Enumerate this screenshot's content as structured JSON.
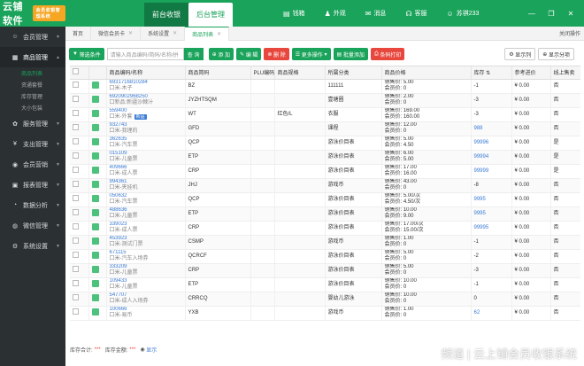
{
  "app": {
    "logo": "云铺软件",
    "version_badge": "会员收银管理系统"
  },
  "main_tabs": [
    "前台收银",
    "后台管理"
  ],
  "top_links": [
    {
      "icon": "cash-icon",
      "label": "钱箱"
    },
    {
      "icon": "shirt-icon",
      "label": "外观"
    },
    {
      "icon": "mail-icon",
      "label": "消息"
    },
    {
      "icon": "headset-icon",
      "label": "客服"
    },
    {
      "icon": "user-icon",
      "label": "苏祺233"
    }
  ],
  "sidebar": {
    "items": [
      {
        "icon": "user-icon",
        "label": "会员管理"
      },
      {
        "icon": "box-icon",
        "label": "商品管理",
        "open": true
      },
      {
        "icon": "gear-icon",
        "label": "服务管理"
      },
      {
        "icon": "money-icon",
        "label": "支出管理"
      },
      {
        "icon": "marketing-icon",
        "label": "会员营销"
      },
      {
        "icon": "report-icon",
        "label": "报表管理"
      },
      {
        "icon": "chart-icon",
        "label": "数据分析"
      },
      {
        "icon": "wechat-icon",
        "label": "微信管理"
      },
      {
        "icon": "settings-icon",
        "label": "系统设置"
      }
    ],
    "sub_items": [
      "商品列表",
      "资通套餐",
      "库存管理",
      "大小包装"
    ]
  },
  "page_tabs": [
    "首页",
    "微信会员卡",
    "系统设置",
    "商品列表"
  ],
  "close_ops": "关闭操作",
  "toolbar": {
    "filter": "筛选条件",
    "search_placeholder": "请输入商品编码/简码/名称/拼",
    "search": "查 询",
    "add": "添 加",
    "edit": "编 辑",
    "delete": "删 除",
    "more": "更多操作",
    "batch_add": "批量添加",
    "print": "条码打印",
    "show_cols": "显示列",
    "show_sub": "显示分项"
  },
  "table": {
    "headers": [
      "",
      "",
      "商品编码/名称",
      "商品简码",
      "PLU编码",
      "商品规格",
      "所属分类",
      "商品价格",
      "库存",
      "参考进价",
      "线上售卖"
    ],
    "rows": [
      {
        "code": "6931716810284",
        "name": "口米-木子",
        "short": "BZ",
        "plu": "",
        "spec": "",
        "cat": "111111",
        "price1": "销售价: 5.00",
        "price2": "会员价: 0",
        "stock": "-1",
        "cost": "¥ 0.00",
        "online": "否"
      },
      {
        "code": "6920902968250",
        "name": "口新品:新疆沙棘汁",
        "short": "JYZHTSQM",
        "plu": "",
        "spec": "",
        "cat": "壹塘圈",
        "price1": "销售价: 2.00",
        "price2": "会员价: 0",
        "stock": "-3",
        "cost": "¥ 0.00",
        "online": "否"
      },
      {
        "code": "559400",
        "name": "口米-外套",
        "short": "WT",
        "plu": "",
        "spec": "红色/L",
        "cat": "衣服",
        "price1": "销售价: 169.00",
        "price2": "会员价: 160.00",
        "stock": "-3",
        "cost": "¥ 0.00",
        "online": "否",
        "new": "新品"
      },
      {
        "code": "932743",
        "name": "口米-我理的",
        "short": "GFD",
        "plu": "",
        "spec": "",
        "cat": "课程",
        "price1": "销售价: 12.00",
        "price2": "会员价: 0",
        "stock": "988",
        "cost": "¥ 0.00",
        "online": "否"
      },
      {
        "code": "362635",
        "name": "口米-汽车票",
        "short": "QCP",
        "plu": "",
        "spec": "",
        "cat": "游泳价目表",
        "price1": "销售价: 5.00",
        "price2": "会员价: 4.50",
        "stock": "99996",
        "cost": "¥ 0.00",
        "online": "是"
      },
      {
        "code": "015109",
        "name": "口米-儿童票",
        "short": "ETP",
        "plu": "",
        "spec": "",
        "cat": "游泳价目表",
        "price1": "销售价: 6.00",
        "price2": "会员价: 5.00",
        "stock": "99994",
        "cost": "¥ 0.00",
        "online": "是"
      },
      {
        "code": "409666",
        "name": "口米-成人票",
        "short": "CRP",
        "plu": "",
        "spec": "",
        "cat": "游泳价目表",
        "price1": "销售价: 17.00",
        "price2": "会员价: 16.00",
        "stock": "99999",
        "cost": "¥ 0.00",
        "online": "是"
      },
      {
        "code": "994361",
        "name": "口米-夹娃机",
        "short": "JHJ",
        "plu": "",
        "spec": "",
        "cat": "游戏币",
        "price1": "销售价: 43.00",
        "price2": "会员价: 0",
        "stock": "-8",
        "cost": "¥ 0.00",
        "online": "否"
      },
      {
        "code": "050632",
        "name": "口米-汽车票",
        "short": "QCP",
        "plu": "",
        "spec": "",
        "cat": "游泳价目表",
        "price1": "销售价: 5.00/次",
        "price2": "会员价: 4.50/次",
        "stock": "9995",
        "cost": "¥ 0.00",
        "online": "否"
      },
      {
        "code": "488636",
        "name": "口米-儿童票",
        "short": "ETP",
        "plu": "",
        "spec": "",
        "cat": "游泳价目表",
        "price1": "销售价: 10.00",
        "price2": "会员价: 9.00",
        "stock": "9995",
        "cost": "¥ 0.00",
        "online": "否"
      },
      {
        "code": "339023",
        "name": "口米-成人票",
        "short": "CRP",
        "plu": "",
        "spec": "",
        "cat": "游泳价目表",
        "price1": "销售价: 17.00/次",
        "price2": "会员价: 15.00/次",
        "stock": "99995",
        "cost": "¥ 0.00",
        "online": "否"
      },
      {
        "code": "453923",
        "name": "口米-测试门票",
        "short": "CSMP",
        "plu": "",
        "spec": "",
        "cat": "游戏币",
        "price1": "销售价: 1.00",
        "price2": "会员价: 0",
        "stock": "-1",
        "cost": "¥ 0.00",
        "online": "否"
      },
      {
        "code": "671115",
        "name": "口米-汽车入场券",
        "short": "QCRCF",
        "plu": "",
        "spec": "",
        "cat": "游泳价目表",
        "price1": "销售价: 5.00",
        "price2": "会员价: 0",
        "stock": "-2",
        "cost": "¥ 0.00",
        "online": "否"
      },
      {
        "code": "333209",
        "name": "口米-儿童票",
        "short": "CRP",
        "plu": "",
        "spec": "",
        "cat": "游泳价目表",
        "price1": "销售价: 5.00",
        "price2": "会员价: 0",
        "stock": "-3",
        "cost": "¥ 0.00",
        "online": "否"
      },
      {
        "code": "109433",
        "name": "口米-儿童票",
        "short": "ETP",
        "plu": "",
        "spec": "",
        "cat": "游泳价目表",
        "price1": "销售价: 10.00",
        "price2": "会员价: 0",
        "stock": "-1",
        "cost": "¥ 0.00",
        "online": "否"
      },
      {
        "code": "547707",
        "name": "口米-成人入场券",
        "short": "CRRCQ",
        "plu": "",
        "spec": "",
        "cat": "婴幼儿游泳",
        "price1": "销售价: 10.00",
        "price2": "会员价: 0",
        "stock": "0",
        "cost": "¥ 0.00",
        "online": "否"
      },
      {
        "code": "100666",
        "name": "口米-易币",
        "short": "YXB",
        "plu": "",
        "spec": "",
        "cat": "游戏币",
        "price1": "销售价: 1.00",
        "price2": "会员价: 0",
        "stock": "62",
        "cost": "¥ 0.00",
        "online": "否"
      }
    ]
  },
  "footer": {
    "stock_label": "库存合计:",
    "stock_value": "***",
    "price_label": "库存金额:",
    "price_value": "***",
    "show": "显示"
  },
  "watermark": "频道 | 云上铺会员收银系统",
  "colors": {
    "brand": "#1aa35a",
    "danger": "#e8473e",
    "sidebar": "#2b3033"
  }
}
